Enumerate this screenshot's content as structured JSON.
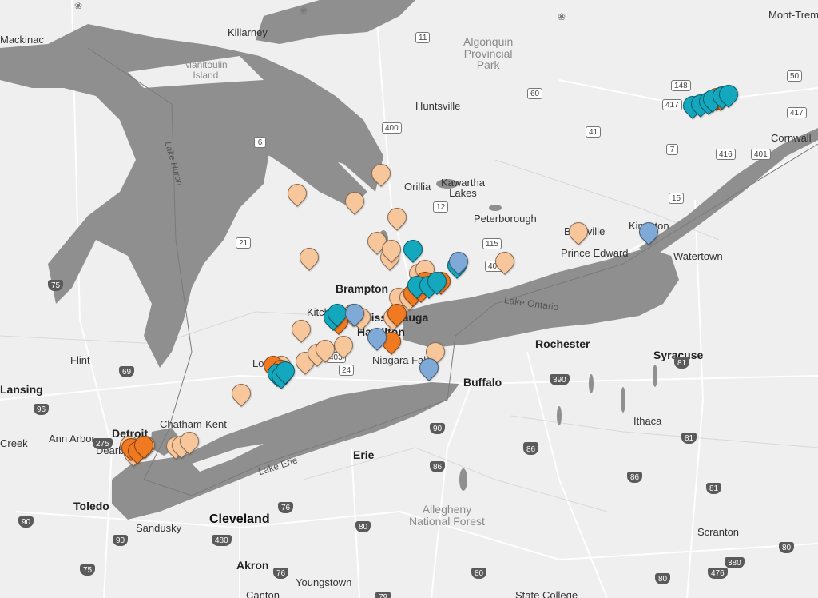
{
  "map": {
    "colors": {
      "land": "#efefef",
      "water": "#8f8f8f",
      "roads": "#ffffff",
      "pin_peach": "#f8c69b",
      "pin_orange": "#f07a22",
      "pin_teal": "#14a8bf",
      "pin_blue": "#7fa9d6"
    },
    "places": [
      {
        "name": "Mackinac",
        "cls": "city"
      },
      {
        "name": "Killarney",
        "cls": "city"
      },
      {
        "name": "Manitoulin\nIsland",
        "cls": "park"
      },
      {
        "name": "Algonquin\nProvincial\nPark",
        "cls": "park"
      },
      {
        "name": "Huntsville",
        "cls": "city"
      },
      {
        "name": "Mont-Tremb",
        "cls": "city"
      },
      {
        "name": "Cornwall",
        "cls": "city"
      },
      {
        "name": "Orillia",
        "cls": "city"
      },
      {
        "name": "Kawartha\nLakes",
        "cls": "city"
      },
      {
        "name": "Peterborough",
        "cls": "city"
      },
      {
        "name": "Belleville",
        "cls": "city"
      },
      {
        "name": "Prince Edward",
        "cls": "city"
      },
      {
        "name": "Kingston",
        "cls": "city"
      },
      {
        "name": "Watertown",
        "cls": "city"
      },
      {
        "name": "Brampton",
        "cls": "bigcity"
      },
      {
        "name": "Mississauga",
        "cls": "bigcity"
      },
      {
        "name": "Hamilton",
        "cls": "bigcity"
      },
      {
        "name": "Niagara Falls",
        "cls": "city"
      },
      {
        "name": "Buffalo",
        "cls": "bigcity"
      },
      {
        "name": "Rochester",
        "cls": "bigcity"
      },
      {
        "name": "Syracuse",
        "cls": "bigcity"
      },
      {
        "name": "Flint",
        "cls": "city"
      },
      {
        "name": "Lansing",
        "cls": "bigcity"
      },
      {
        "name": "Ann Arbor",
        "cls": "city"
      },
      {
        "name": "Detroit",
        "cls": "bigcity"
      },
      {
        "name": "Dearborn",
        "cls": "city"
      },
      {
        "name": "Chatham-Kent",
        "cls": "city"
      },
      {
        "name": "Ithaca",
        "cls": "city"
      },
      {
        "name": "Erie",
        "cls": "bigcity"
      },
      {
        "name": "Toledo",
        "cls": "bigcity"
      },
      {
        "name": "Sandusky",
        "cls": "city"
      },
      {
        "name": "Cleveland",
        "cls": "big"
      },
      {
        "name": "Allegheny\nNational Forest",
        "cls": "park"
      },
      {
        "name": "Akron",
        "cls": "bigcity"
      },
      {
        "name": "Youngstown",
        "cls": "city"
      },
      {
        "name": "Scranton",
        "cls": "city"
      },
      {
        "name": "Canton",
        "cls": "city"
      },
      {
        "name": "State College",
        "cls": "city"
      },
      {
        "name": "Creek",
        "cls": "city"
      },
      {
        "name": "London",
        "cls": "city"
      },
      {
        "name": "Kitchener",
        "cls": "city"
      },
      {
        "name": "Lake Huron",
        "cls": "lakev"
      },
      {
        "name": "Lake Ontario",
        "cls": "lake lakeont"
      },
      {
        "name": "Lake Erie",
        "cls": "lake lakeerie"
      }
    ],
    "shields": [
      {
        "num": "11",
        "kind": "ca"
      },
      {
        "num": "60",
        "kind": "ca"
      },
      {
        "num": "41",
        "kind": "ca"
      },
      {
        "num": "400",
        "kind": "ca"
      },
      {
        "num": "6",
        "kind": "ca"
      },
      {
        "num": "12",
        "kind": "ca"
      },
      {
        "num": "115",
        "kind": "ca"
      },
      {
        "num": "401",
        "kind": "ca"
      },
      {
        "num": "21",
        "kind": "ca"
      },
      {
        "num": "24",
        "kind": "ca"
      },
      {
        "num": "403",
        "kind": "ca"
      },
      {
        "num": "148",
        "kind": "ca"
      },
      {
        "num": "417",
        "kind": "ca"
      },
      {
        "num": "416",
        "kind": "ca"
      },
      {
        "num": "7",
        "kind": "ca"
      },
      {
        "num": "15",
        "kind": "ca"
      },
      {
        "num": "417",
        "kind": "ca"
      },
      {
        "num": "401",
        "kind": "ca"
      },
      {
        "num": "50",
        "kind": "ca"
      },
      {
        "num": "75",
        "kind": "interstate"
      },
      {
        "num": "69",
        "kind": "interstate"
      },
      {
        "num": "96",
        "kind": "interstate"
      },
      {
        "num": "275",
        "kind": "interstate"
      },
      {
        "num": "75",
        "kind": "interstate"
      },
      {
        "num": "90",
        "kind": "interstate"
      },
      {
        "num": "80",
        "kind": "interstate"
      },
      {
        "num": "90",
        "kind": "interstate"
      },
      {
        "num": "480",
        "kind": "interstate"
      },
      {
        "num": "76",
        "kind": "interstate"
      },
      {
        "num": "80",
        "kind": "interstate"
      },
      {
        "num": "90",
        "kind": "interstate"
      },
      {
        "num": "390",
        "kind": "interstate"
      },
      {
        "num": "86",
        "kind": "interstate"
      },
      {
        "num": "81",
        "kind": "interstate"
      },
      {
        "num": "81",
        "kind": "interstate"
      },
      {
        "num": "86",
        "kind": "interstate"
      },
      {
        "num": "81",
        "kind": "interstate"
      },
      {
        "num": "476",
        "kind": "interstate"
      },
      {
        "num": "380",
        "kind": "interstate"
      },
      {
        "num": "80",
        "kind": "interstate"
      },
      {
        "num": "80",
        "kind": "interstate"
      },
      {
        "num": "79",
        "kind": "interstate"
      },
      {
        "num": "76",
        "kind": "interstate"
      },
      {
        "num": "86",
        "kind": "interstate"
      },
      {
        "num": "86",
        "kind": "interstate"
      }
    ],
    "markers": [
      {
        "color": "peach",
        "count": 31
      },
      {
        "color": "orange",
        "count": 14
      },
      {
        "color": "teal",
        "count": 16
      },
      {
        "color": "blue",
        "count": 5
      }
    ]
  }
}
